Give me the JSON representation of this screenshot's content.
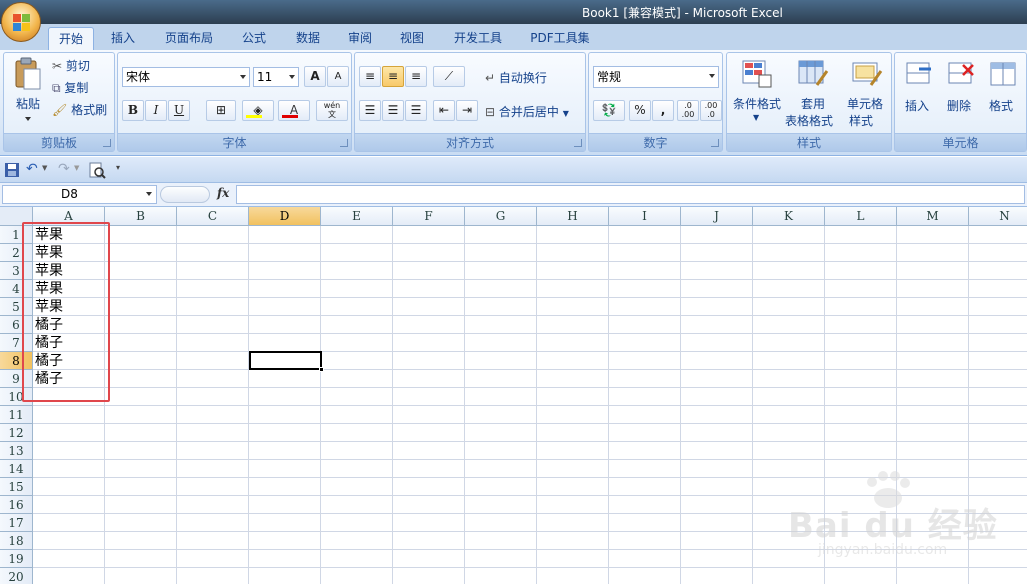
{
  "window": {
    "title": "Book1  [兼容模式] - Microsoft Excel"
  },
  "tabs": [
    {
      "label": "开始",
      "active": true
    },
    {
      "label": "插入"
    },
    {
      "label": "页面布局"
    },
    {
      "label": "公式"
    },
    {
      "label": "数据"
    },
    {
      "label": "审阅"
    },
    {
      "label": "视图"
    },
    {
      "label": "开发工具"
    },
    {
      "label": "PDF工具集"
    }
  ],
  "ribbon": {
    "clipboard": {
      "label": "剪贴板",
      "paste": "粘贴",
      "cut": "剪切",
      "copy": "复制",
      "format_painter": "格式刷"
    },
    "font": {
      "label": "字体",
      "font_name": "宋体",
      "font_size": "11",
      "bold": "B",
      "italic": "I",
      "underline": "U",
      "grow": "A",
      "shrink": "A",
      "phonetic": "wén\n文"
    },
    "alignment": {
      "label": "对齐方式",
      "wrap": "自动换行",
      "merge": "合并后居中"
    },
    "number": {
      "label": "数字",
      "format": "常规",
      "percent": "%",
      "comma": ",",
      "inc_dec": ".0\n.00",
      "dec_dec": ".00\n.0"
    },
    "styles": {
      "label": "样式",
      "conditional": "条件格式",
      "table_style_1": "套用",
      "table_style_2": "表格格式",
      "cell_style_1": "单元格",
      "cell_style_2": "样式"
    },
    "cells": {
      "label": "单元格",
      "insert": "插入",
      "delete": "删除",
      "format": "格式"
    }
  },
  "formula_bar": {
    "name_box": "D8",
    "fx": "fx",
    "formula": ""
  },
  "grid": {
    "columns": [
      "A",
      "B",
      "C",
      "D",
      "E",
      "F",
      "G",
      "H",
      "I",
      "J",
      "K",
      "L",
      "M",
      "N"
    ],
    "selected_column": "D",
    "rows": [
      "1",
      "2",
      "3",
      "4",
      "5",
      "6",
      "7",
      "8",
      "9",
      "10",
      "11",
      "12",
      "13",
      "14",
      "15",
      "16",
      "17",
      "18",
      "19",
      "20"
    ],
    "selected_row": "8",
    "column_a": [
      "苹果",
      "苹果",
      "苹果",
      "苹果",
      "苹果",
      "橘子",
      "橘子",
      "橘子",
      "橘子"
    ]
  },
  "watermark": {
    "text": "Bai du 经验",
    "url": "jingyan.baidu.com"
  },
  "colors": {
    "accent": "#15428b",
    "highlight": "#e0474c",
    "selected_header": "#f1c15f"
  }
}
